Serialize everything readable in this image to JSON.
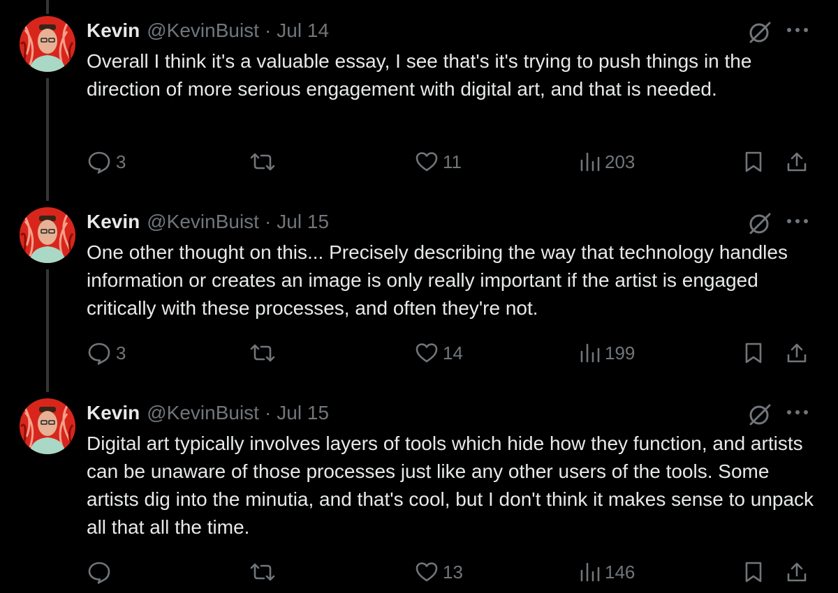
{
  "tweets": [
    {
      "name": "Kevin",
      "handle": "@KevinBuist",
      "separator": "·",
      "date": "Jul 14",
      "text": "Overall I think it's a valuable essay, I see that's it's trying to push things in the direction of more serious engagement with digital art, and that is needed.",
      "replies": "3",
      "retweets": "",
      "likes": "11",
      "views": "203"
    },
    {
      "name": "Kevin",
      "handle": "@KevinBuist",
      "separator": "·",
      "date": "Jul 15",
      "text": "One other thought on this... Precisely describing the way that technology handles information or creates an image is only really important if the artist is engaged critically with these processes, and often they're not.",
      "replies": "3",
      "retweets": "",
      "likes": "14",
      "views": "199"
    },
    {
      "name": "Kevin",
      "handle": "@KevinBuist",
      "separator": "·",
      "date": "Jul 15",
      "text": "Digital art typically involves layers of tools which hide how they function, and artists can be unaware of those processes just like any other users of the tools. Some artists dig into the minutia, and that's cool, but I don't think it makes sense to unpack all that all the time.",
      "replies": "",
      "retweets": "",
      "likes": "13",
      "views": "146"
    }
  ],
  "icons": {
    "reply": "reply-icon",
    "retweet": "retweet-icon",
    "like": "heart-icon",
    "views": "views-icon",
    "bookmark": "bookmark-icon",
    "share": "share-icon",
    "grok": "grok-icon",
    "more": "more-icon"
  },
  "colors": {
    "background": "#000000",
    "text": "#e7e9ea",
    "muted": "#71767b",
    "thread_line": "#333639",
    "avatar_bg": "#d8261c"
  }
}
